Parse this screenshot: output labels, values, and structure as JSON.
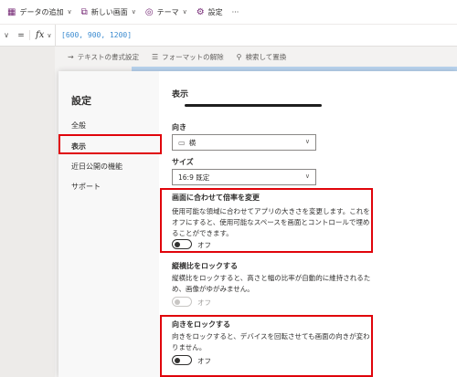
{
  "command_bar": {
    "add_data": "データの追加",
    "new_screen": "新しい画面",
    "theme": "テーマ",
    "settings": "設定",
    "more": "···"
  },
  "formula_bar": {
    "eq": "=",
    "fx": "fx",
    "value": "[600, 900, 1200]"
  },
  "text_toolbar": {
    "text_format": "テキストの書式設定",
    "clear_format": "フォーマットの解除",
    "find_replace": "検索して置換"
  },
  "settings_dialog": {
    "title": "設定",
    "nav": [
      "全般",
      "表示",
      "近日公開の機能",
      "サポート"
    ],
    "selected_nav": "表示",
    "section_title": "表示",
    "orientation": {
      "label": "向き",
      "value": "横"
    },
    "size": {
      "label": "サイズ",
      "value": "16:9 既定"
    },
    "scale_to_fit": {
      "label": "画面に合わせて倍率を変更",
      "description": "使用可能な領域に合わせてアプリの大きさを変更します。これをオフにすると、使用可能なスペースを画面とコントロールで埋めることができます。",
      "toggle": "オフ"
    },
    "lock_aspect": {
      "label": "縦横比をロックする",
      "description": "縦横比をロックすると、高さと幅の比率が自動的に維持されるため、画像がゆがみません。",
      "toggle": "オフ"
    },
    "lock_orientation": {
      "label": "向きをロックする",
      "description": "向きをロックすると、デバイスを回転させても画面の向きが変わりません。",
      "toggle": "オフ"
    }
  },
  "colors": {
    "highlight": "#e0040b",
    "accent": "#742774",
    "formula_value": "#3b8bd0"
  }
}
